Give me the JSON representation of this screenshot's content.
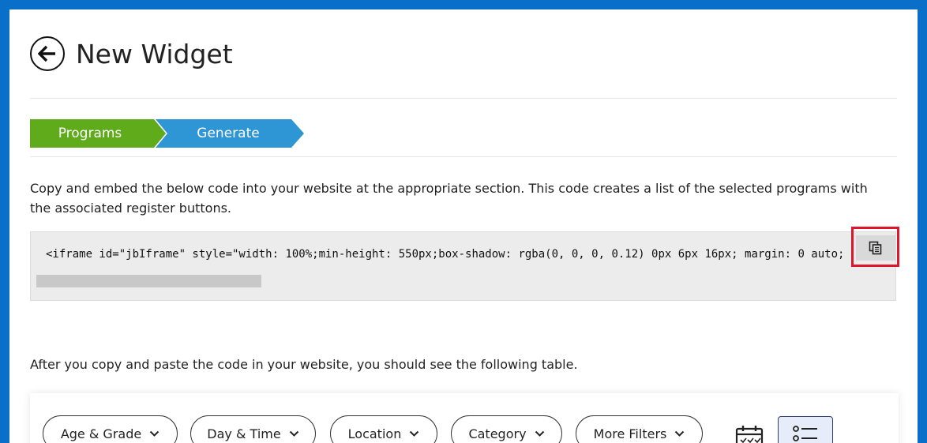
{
  "header": {
    "title": "New Widget",
    "back_icon": "arrow-left-circle-icon"
  },
  "steps": [
    {
      "label": "Programs",
      "color": "#5fab1c"
    },
    {
      "label": "Generate",
      "color": "#2e96d4",
      "check_icon": "check-icon"
    }
  ],
  "description": "Copy and embed the below code into your website at the appropriate section. This code creates a list of the selected programs with the associated register buttons.",
  "code": "<iframe id=\"jbIframe\" style=\"width: 100%;min-height: 550px;box-shadow: rgba(0, 0, 0, 0.12) 0px 6px 16px; margin: 0 auto;",
  "copy_icon": "copy-icon",
  "after_text": "After you copy and paste the code in your website, you should see the following table.",
  "filters": [
    "Age & Grade",
    "Day & Time",
    "Location",
    "Category",
    "More Filters"
  ],
  "view_icons": {
    "calendar": "calendar-icon",
    "list": "list-icon"
  }
}
